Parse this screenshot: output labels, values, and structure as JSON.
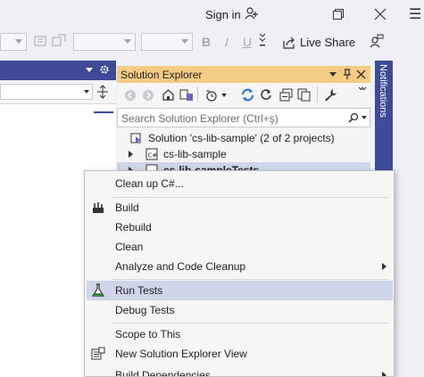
{
  "titlebar": {
    "signin_label": "Sign in",
    "menu_glyph": "☰"
  },
  "toolbar": {
    "bold": "B",
    "italic": "I",
    "underline": "U",
    "liveshare_label": "Live Share"
  },
  "solution_explorer": {
    "title": "Solution Explorer",
    "search_placeholder": "Search Solution Explorer (Ctrl+ş)",
    "tree": [
      {
        "label": "Solution 'cs-lib-sample' (2 of 2 projects)"
      },
      {
        "label": "cs-lib-sample"
      },
      {
        "label": "cs-lib-sampleTests"
      }
    ]
  },
  "notifications": {
    "label": "Notifications"
  },
  "context_menu": {
    "items": [
      {
        "label": "Clean up C#...",
        "icon": ""
      },
      {
        "label": "Build",
        "icon": "build-icon"
      },
      {
        "label": "Rebuild",
        "icon": ""
      },
      {
        "label": "Clean",
        "icon": ""
      },
      {
        "label": "Analyze and Code Cleanup",
        "icon": "",
        "submenu": true
      },
      {
        "label": "Run Tests",
        "icon": "flask-icon",
        "highlighted": true
      },
      {
        "label": "Debug Tests",
        "icon": ""
      },
      {
        "label": "Scope to This",
        "icon": ""
      },
      {
        "label": "New Solution Explorer View",
        "icon": "new-view-icon"
      },
      {
        "label": "Build Dependencies",
        "icon": "",
        "submenu": true
      }
    ]
  },
  "colors": {
    "accent": "#3d4a97",
    "panel_title": "#f5cc84",
    "menu_highlight": "#cfd6ea"
  }
}
